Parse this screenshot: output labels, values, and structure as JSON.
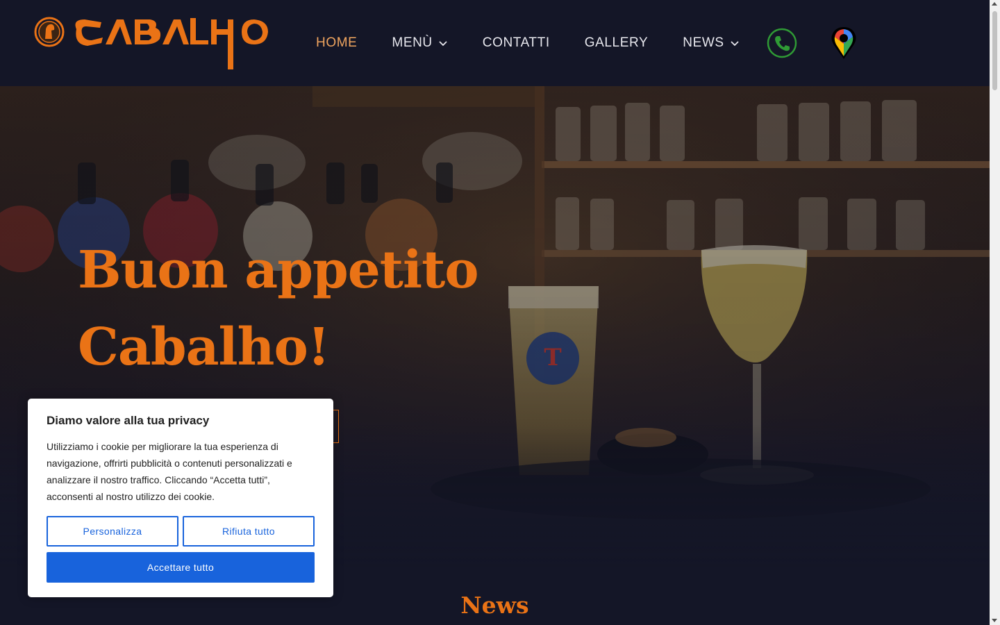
{
  "brand": {
    "logo_text": "CABALHO",
    "logo_icon": "horse-head-icon",
    "accent_color": "#ea7316"
  },
  "nav": {
    "items": [
      {
        "label": "HOME",
        "active": true,
        "dropdown": false
      },
      {
        "label": "MENÙ",
        "active": false,
        "dropdown": true
      },
      {
        "label": "CONTATTI",
        "active": false,
        "dropdown": false
      },
      {
        "label": "GALLERY",
        "active": false,
        "dropdown": false
      },
      {
        "label": "NEWS",
        "active": false,
        "dropdown": true
      }
    ],
    "phone_icon": "phone-icon",
    "map_icon": "map-pin-icon"
  },
  "hero": {
    "title_line1": "Buon appetito",
    "title_line2": "Cabalho!"
  },
  "news": {
    "heading": "News"
  },
  "cookie": {
    "title": "Diamo valore alla tua privacy",
    "text": "Utilizziamo i cookie per migliorare la tua esperienza di navigazione, offrirti pubblicità o contenuti personalizzati e analizzare il nostro traffico. Cliccando “Accetta tutti”, acconsenti al nostro utilizzo dei cookie.",
    "customize_label": "Personalizza",
    "reject_label": "Rifiuta tutto",
    "accept_label": "Accettare tutto",
    "button_color": "#1863dc"
  }
}
